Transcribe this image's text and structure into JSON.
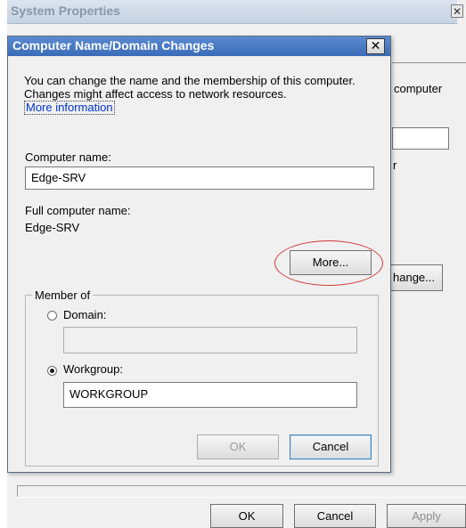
{
  "background_window": {
    "title": "System Properties",
    "close_glyph": "✕",
    "partial_text_computer": "computer",
    "partial_text_r": "r",
    "partial_change_button": "hange...",
    "buttons": {
      "ok": "OK",
      "cancel": "Cancel",
      "apply": "Apply"
    }
  },
  "dialog": {
    "title": "Computer Name/Domain Changes",
    "close_glyph": "✕",
    "description": "You can change the name and the membership of this computer. Changes might affect access to network resources.",
    "more_information_link": "More information",
    "computer_name_label": "Computer name:",
    "computer_name_value": "Edge-SRV",
    "full_computer_name_label": "Full computer name:",
    "full_computer_name_value": "Edge-SRV",
    "more_button": "More...",
    "member_of": {
      "legend": "Member of",
      "domain_label": "Domain:",
      "domain_value": "",
      "domain_selected": false,
      "workgroup_label": "Workgroup:",
      "workgroup_value": "WORKGROUP",
      "workgroup_selected": true
    },
    "buttons": {
      "ok": "OK",
      "ok_enabled": false,
      "cancel": "Cancel"
    }
  },
  "annotation": {
    "highlight_color": "#d03a3a",
    "highlighted_element": "more-button"
  },
  "colors": {
    "title_bar_active": "#3a6bb8",
    "link": "#0033cc"
  }
}
